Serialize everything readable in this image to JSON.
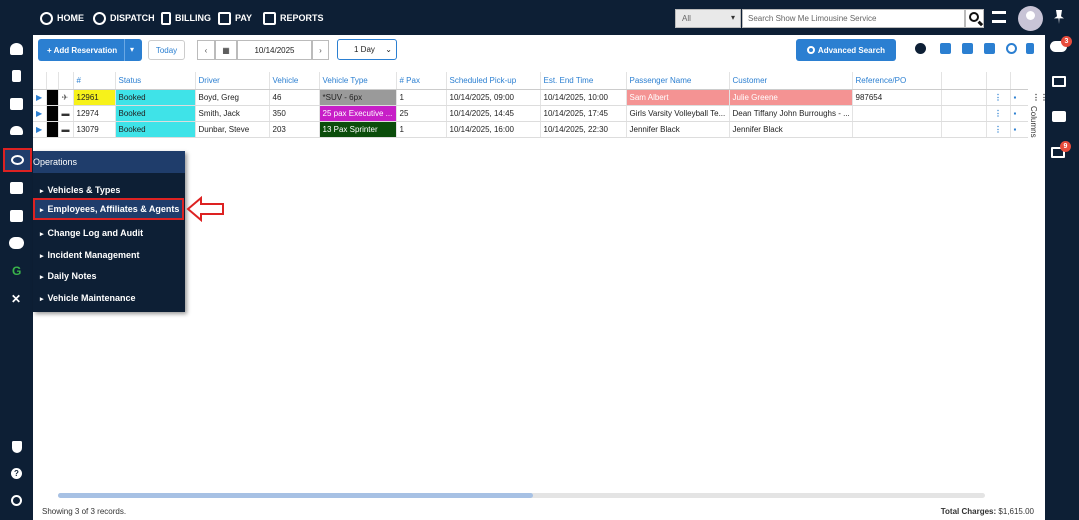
{
  "nav": {
    "home": "HOME",
    "dispatch": "DISPATCH",
    "billing": "BILLING",
    "pay": "PAY",
    "reports": "REPORTS"
  },
  "search": {
    "scope": "All",
    "placeholder": "Search Show Me Limousine Service"
  },
  "toolbar": {
    "add": "+ Add Reservation",
    "today": "Today",
    "date": "10/14/2025",
    "range": "1 Day",
    "advanced": "Advanced Search"
  },
  "table": {
    "headers": [
      "#",
      "Status",
      "Driver",
      "Vehicle",
      "Vehicle Type",
      "# Pax",
      "Scheduled Pick-up",
      "Est. End Time",
      "Passenger Name",
      "Customer",
      "Reference/PO"
    ],
    "rows": [
      {
        "id": "12961",
        "status": "Booked",
        "driver": "Boyd, Greg",
        "vehicle": "46",
        "vtype": "*SUV - 6px",
        "pax": "1",
        "pickup": "10/14/2025, 09:00",
        "end": "10/14/2025, 10:00",
        "passenger": "Sam Albert",
        "customer": "Julie Greene",
        "ref": "987654"
      },
      {
        "id": "12974",
        "status": "Booked",
        "driver": "Smith, Jack",
        "vehicle": "350",
        "vtype": "25 pax Executive ...",
        "pax": "25",
        "pickup": "10/14/2025, 14:45",
        "end": "10/14/2025, 17:45",
        "passenger": "Girls Varsity Volleyball Te...",
        "customer": "Dean Tiffany John Burroughs - ...",
        "ref": ""
      },
      {
        "id": "13079",
        "status": "Booked",
        "driver": "Dunbar, Steve",
        "vehicle": "203",
        "vtype": "13 Pax Sprinter",
        "pax": "1",
        "pickup": "10/14/2025, 16:00",
        "end": "10/14/2025, 22:30",
        "passenger": "Jennifer Black",
        "customer": "Jennifer Black",
        "ref": ""
      }
    ],
    "columns_label": "Columns"
  },
  "menu": {
    "title": "Operations",
    "items": [
      "Vehicles & Types",
      "Employees, Affiliates & Agents",
      "Change Log and Audit",
      "Incident Management",
      "Daily Notes",
      "Vehicle Maintenance"
    ]
  },
  "footer": {
    "records": "Showing 3 of 3 records.",
    "total_label": "Total Charges:",
    "total_value": "$1,615.00"
  },
  "badges": {
    "cloud": "3",
    "panel": "9"
  },
  "colors": {
    "navy": "#0d1f35",
    "accent": "#2b7fd1",
    "booked": "#3fe3e8",
    "highlight_red": "#d22"
  }
}
